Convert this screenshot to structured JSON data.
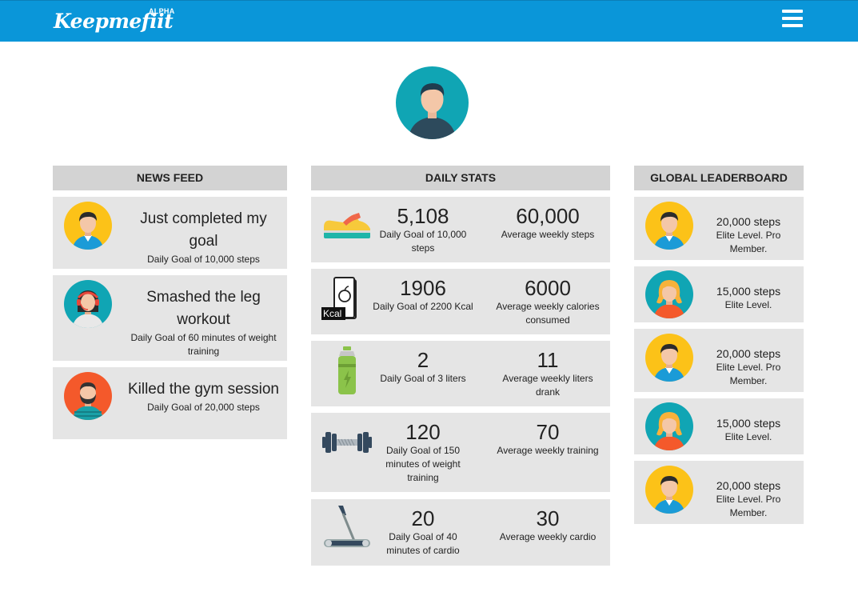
{
  "header": {
    "logo": "Keepmefiit",
    "badge": "ALPHA",
    "menu_icon": "hamburger-icon",
    "color": "#0a96d9"
  },
  "profile": {
    "icon": "user-avatar-icon"
  },
  "news_feed": {
    "title": "NEWS FEED",
    "items": [
      {
        "title": "Just completed my goal",
        "subtitle": "Daily Goal of 10,000 steps",
        "avatar": "man-avatar-yellow-icon"
      },
      {
        "title": "Smashed the leg workout",
        "subtitle": "Daily Goal of 60 minutes of weight training",
        "avatar": "woman-headset-avatar-icon"
      },
      {
        "title": "Killed the gym session",
        "subtitle": "Daily Goal of 20,000 steps",
        "avatar": "bearded-man-avatar-icon"
      }
    ]
  },
  "daily_stats": {
    "title": "DAILY STATS",
    "items": [
      {
        "icon": "sneaker-icon",
        "value": "5,108",
        "goal": "Daily Goal of 10,000 steps",
        "avg_value": "60,000",
        "avg_label": "Average weekly steps"
      },
      {
        "icon": "calorie-book-icon",
        "icon_label": "Kcal",
        "value": "1906",
        "goal": "Daily Goal of 2200 Kcal",
        "avg_value": "6000",
        "avg_label": "Average weekly calories consumed"
      },
      {
        "icon": "water-bottle-icon",
        "value": "2",
        "goal": "Daily Goal of 3 liters",
        "avg_value": "11",
        "avg_label": "Average weekly liters drank"
      },
      {
        "icon": "dumbbell-icon",
        "value": "120",
        "goal": "Daily Goal of 150 minutes of weight training",
        "avg_value": "70",
        "avg_label": "Average weekly training"
      },
      {
        "icon": "treadmill-icon",
        "value": "20",
        "goal": "Daily Goal of 40 minutes of cardio",
        "avg_value": "30",
        "avg_label": "Average weekly cardio"
      }
    ]
  },
  "leaderboard": {
    "title": "GLOBAL LEADERBOARD",
    "items": [
      {
        "steps": "20,000 steps",
        "level": "Elite Level. Pro Member.",
        "avatar": "man-avatar-yellow-icon"
      },
      {
        "steps": "15,000 steps",
        "level": "Elite Level.",
        "avatar": "woman-avatar-teal-icon"
      },
      {
        "steps": "20,000 steps",
        "level": "Elite Level. Pro Member.",
        "avatar": "man-avatar-yellow-icon"
      },
      {
        "steps": "15,000 steps",
        "level": "Elite Level.",
        "avatar": "woman-avatar-teal-icon"
      },
      {
        "steps": "20,000 steps",
        "level": "Elite Level. Pro Member.",
        "avatar": "man-avatar-yellow-icon"
      }
    ]
  }
}
